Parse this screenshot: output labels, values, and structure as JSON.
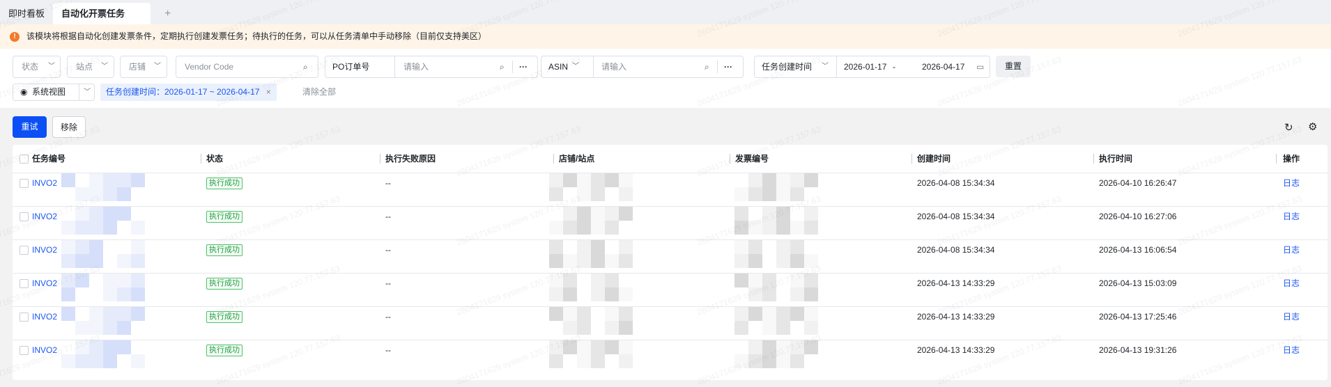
{
  "tabs": [
    {
      "label": "即时看板"
    },
    {
      "label": "自动化开票任务"
    }
  ],
  "add_tab": "+",
  "notice": "该模块将根据自动化创建发票条件，定期执行创建发票任务；待执行的任务，可以从任务清单中手动移除（目前仅支持美区）",
  "filters": {
    "status": "状态",
    "site": "站点",
    "store": "店铺",
    "vendor_code_placeholder": "Vendor Code",
    "po_label": "PO订单号",
    "po_placeholder": "请输入",
    "asin_label": "ASIN",
    "asin_placeholder": "请输入",
    "date_type": "任务创建时间",
    "date_start": "2026-01-17",
    "date_sep": "-",
    "date_end": "2026-04-17",
    "reset": "重置",
    "more": "···"
  },
  "view": {
    "label": "系统视图",
    "chip": "任务创建时间：2026-01-17 ~ 2026-04-17",
    "chip_close": "×",
    "clear_all": "清除全部"
  },
  "toolbar": {
    "retry": "重试",
    "remove": "移除"
  },
  "table": {
    "headers": [
      "任务编号",
      "状态",
      "执行失败原因",
      "店铺/站点",
      "发票编号",
      "创建时间",
      "执行时间",
      "操作"
    ],
    "rows": [
      {
        "id": "INVO2",
        "status": "执行成功",
        "reason": "--",
        "created": "2026-04-08 15:34:34",
        "executed": "2026-04-10 16:26:47",
        "action": "日志"
      },
      {
        "id": "INVO2",
        "status": "执行成功",
        "reason": "--",
        "created": "2026-04-08 15:34:34",
        "executed": "2026-04-10 16:27:06",
        "action": "日志"
      },
      {
        "id": "INVO2",
        "status": "执行成功",
        "reason": "--",
        "created": "2026-04-08 15:34:34",
        "executed": "2026-04-13 16:06:54",
        "action": "日志"
      },
      {
        "id": "INVO2",
        "status": "执行成功",
        "reason": "--",
        "created": "2026-04-13 14:33:29",
        "executed": "2026-04-13 15:03:09",
        "action": "日志"
      },
      {
        "id": "INVO2",
        "status": "执行成功",
        "reason": "--",
        "created": "2026-04-13 14:33:29",
        "executed": "2026-04-13 17:25:46",
        "action": "日志"
      },
      {
        "id": "INVO2",
        "status": "执行成功",
        "reason": "--",
        "created": "2026-04-13 14:33:29",
        "executed": "2026-04-13 19:31:26",
        "action": "日志"
      }
    ]
  },
  "watermark": "2604171629 system 120.77.157.63"
}
